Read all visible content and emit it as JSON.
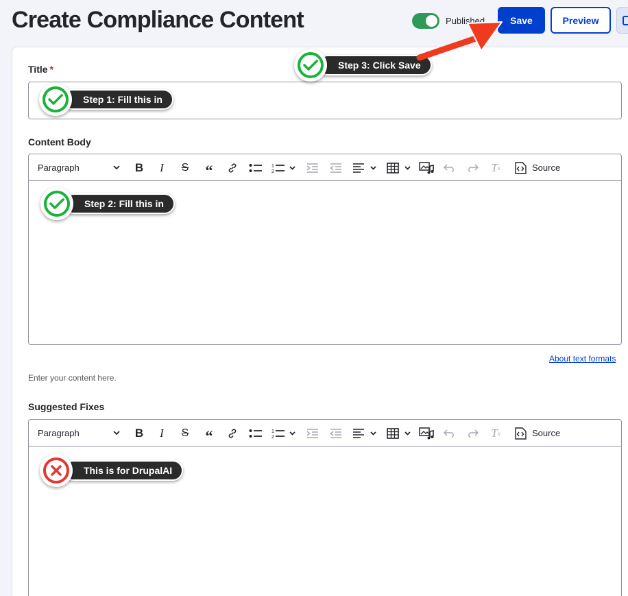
{
  "header": {
    "title": "Create Compliance Content",
    "published_label": "Published",
    "published": true,
    "save_label": "Save",
    "preview_label": "Preview"
  },
  "form": {
    "title_label": "Title",
    "required_mark": "*",
    "title_value": "",
    "body_label": "Content Body",
    "body_value": "",
    "about_formats": "About text formats",
    "body_help": "Enter your content here.",
    "fixes_label": "Suggested Fixes",
    "fixes_value": ""
  },
  "toolbar": {
    "format_select": "Paragraph",
    "source_label": "Source",
    "items": [
      "bold",
      "italic",
      "strikethrough",
      "blockquote",
      "link",
      "bulleted-list",
      "numbered-list",
      "outdent",
      "indent",
      "align",
      "table",
      "media",
      "undo",
      "redo",
      "remove-format",
      "source"
    ]
  },
  "annotations": {
    "step1": "Step 1: Fill this in",
    "step2": "Step 2: Fill this in",
    "step3": "Step 3: Click Save",
    "drupal_ai": "This is for DrupalAI"
  },
  "colors": {
    "primary": "#003ecc",
    "toggle_on": "#2f9a58",
    "check_green": "#17b33a",
    "cross_red": "#e23a32",
    "arrow": "#f03a1e"
  }
}
